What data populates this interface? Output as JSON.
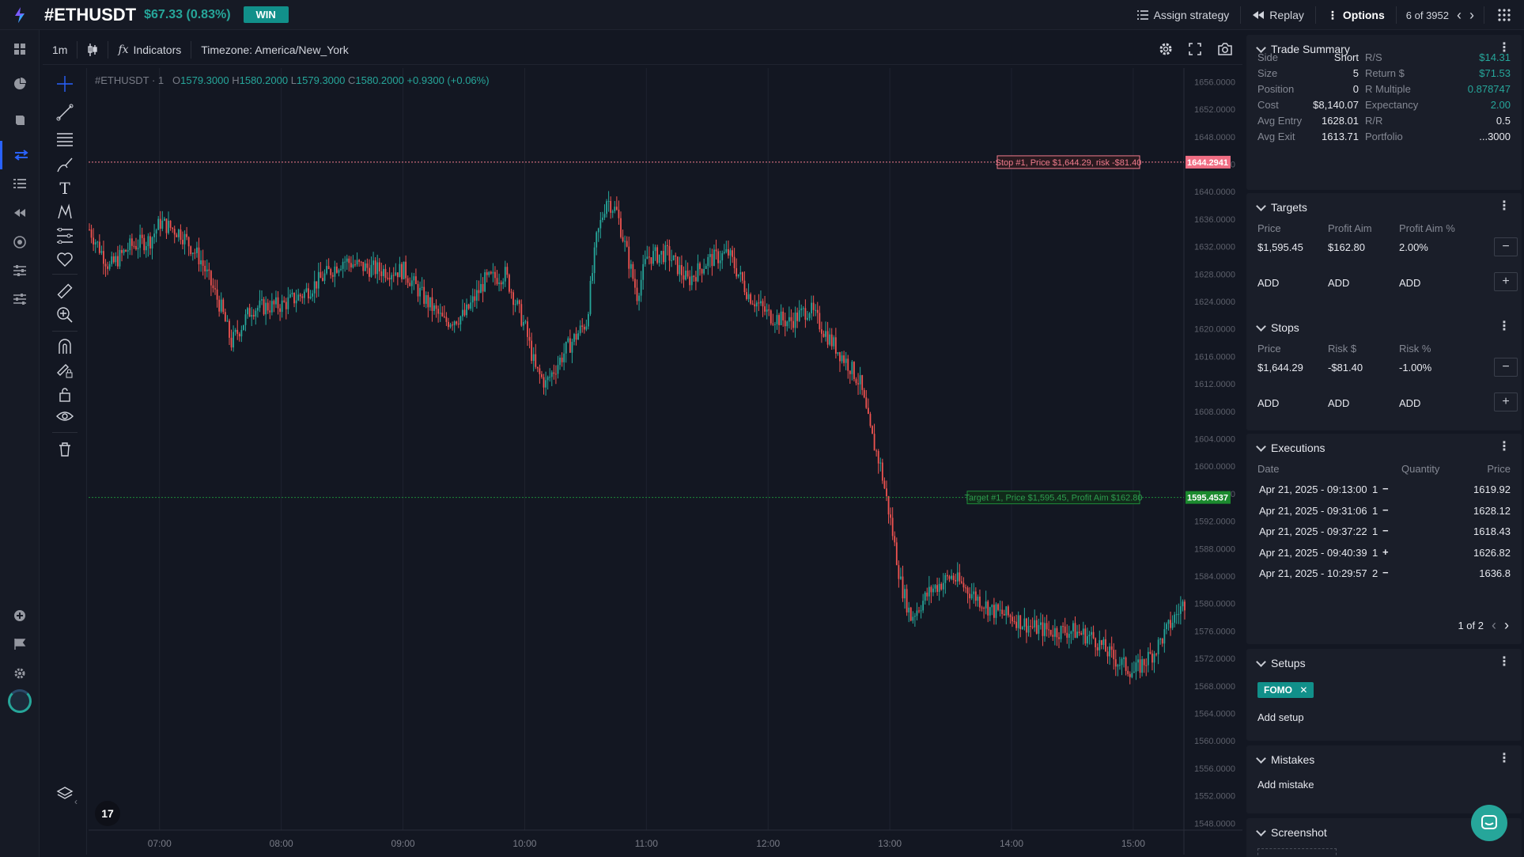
{
  "header": {
    "symbol": "#ETHUSDT",
    "change": "$67.33 (0.83%)",
    "status_badge": "WIN",
    "assign_strategy": "Assign strategy",
    "replay": "Replay",
    "options": "Options",
    "pager": "6 of 3952"
  },
  "chart_toolbar": {
    "interval": "1m",
    "indicators": "Indicators",
    "timezone": "Timezone: America/New_York"
  },
  "legend": {
    "symbol": "#ETHUSDT · 1",
    "o_label": "O",
    "o": "1579.3000",
    "h_label": "H",
    "h": "1580.2000",
    "l_label": "L",
    "l": "1579.3000",
    "c_label": "C",
    "c": "1580.2000",
    "change": "+0.9300 (+0.06%)"
  },
  "chart_data": {
    "type": "candlestick",
    "x_ticks": [
      "07:00",
      "08:00",
      "09:00",
      "10:00",
      "11:00",
      "12:00",
      "13:00",
      "14:00",
      "15:00"
    ],
    "y_ticks": [
      "1656.0000",
      "1652.0000",
      "1648.0000",
      "1644.0000",
      "1640.0000",
      "1636.0000",
      "1632.0000",
      "1628.0000",
      "1624.0000",
      "1620.0000",
      "1616.0000",
      "1612.0000",
      "1608.0000",
      "1604.0000",
      "1600.0000",
      "1596.0000",
      "1592.0000",
      "1588.0000",
      "1584.0000",
      "1580.0000",
      "1576.0000",
      "1572.0000",
      "1568.0000",
      "1564.0000",
      "1560.0000",
      "1556.0000",
      "1552.0000",
      "1548.0000"
    ],
    "y_values": [
      1656,
      1652,
      1648,
      1644,
      1640,
      1636,
      1632,
      1628,
      1624,
      1620,
      1616,
      1612,
      1608,
      1604,
      1600,
      1596,
      1592,
      1588,
      1584,
      1580,
      1576,
      1572,
      1568,
      1564,
      1560,
      1556,
      1552,
      1548
    ],
    "x_range": [
      "06:25",
      "15:25"
    ],
    "ylim": [
      1547,
      1658
    ],
    "price_path": [
      [
        "06:25",
        1634.5
      ],
      [
        "06:35",
        1629
      ],
      [
        "06:45",
        1632
      ],
      [
        "06:55",
        1633
      ],
      [
        "07:00",
        1635.5
      ],
      [
        "07:10",
        1634
      ],
      [
        "07:20",
        1630
      ],
      [
        "07:30",
        1623
      ],
      [
        "07:35",
        1618
      ],
      [
        "07:45",
        1623
      ],
      [
        "08:00",
        1623.5
      ],
      [
        "08:10",
        1625
      ],
      [
        "08:20",
        1627.5
      ],
      [
        "08:30",
        1630
      ],
      [
        "08:40",
        1629
      ],
      [
        "08:50",
        1628.5
      ],
      [
        "09:00",
        1628.5
      ],
      [
        "09:10",
        1624.5
      ],
      [
        "09:20",
        1621
      ],
      [
        "09:30",
        1622
      ],
      [
        "09:40",
        1627
      ],
      [
        "09:50",
        1628
      ],
      [
        "10:00",
        1620
      ],
      [
        "10:05",
        1614
      ],
      [
        "10:10",
        1612
      ],
      [
        "10:20",
        1617
      ],
      [
        "10:30",
        1621
      ],
      [
        "10:35",
        1633
      ],
      [
        "10:40",
        1639
      ],
      [
        "10:45",
        1637
      ],
      [
        "10:50",
        1631
      ],
      [
        "10:55",
        1625
      ],
      [
        "11:00",
        1630.5
      ],
      [
        "11:10",
        1631
      ],
      [
        "11:20",
        1627
      ],
      [
        "11:30",
        1630
      ],
      [
        "11:40",
        1631
      ],
      [
        "11:50",
        1625
      ],
      [
        "12:00",
        1622
      ],
      [
        "12:10",
        1621
      ],
      [
        "12:20",
        1623
      ],
      [
        "12:30",
        1618.5
      ],
      [
        "12:40",
        1614.5
      ],
      [
        "12:45",
        1612
      ],
      [
        "12:50",
        1605
      ],
      [
        "12:55",
        1600
      ],
      [
        "13:00",
        1592
      ],
      [
        "13:05",
        1583
      ],
      [
        "13:10",
        1578
      ],
      [
        "13:20",
        1582
      ],
      [
        "13:30",
        1584
      ],
      [
        "13:40",
        1581.5
      ],
      [
        "13:50",
        1579
      ],
      [
        "14:00",
        1578
      ],
      [
        "14:10",
        1576.5
      ],
      [
        "14:20",
        1576
      ],
      [
        "14:30",
        1576
      ],
      [
        "14:40",
        1575
      ],
      [
        "14:50",
        1572
      ],
      [
        "15:00",
        1570
      ],
      [
        "15:10",
        1573
      ],
      [
        "15:20",
        1578
      ],
      [
        "15:25",
        1580.2
      ]
    ],
    "series": [
      {
        "name": "Stop #1",
        "price": 1644.2941,
        "axis_label": "1644.2941",
        "label": "Stop #1, Price $1,644.29, risk -$81.40",
        "color": "#f07b8c"
      },
      {
        "name": "Target #1",
        "price": 1595.4537,
        "axis_label": "1595.4537",
        "label": "Target #1, Price $1,595.45, Profit Aim $162.80",
        "color": "#1e8a3a"
      }
    ],
    "colors": {
      "up": "#26a69a",
      "down": "#ef5350"
    }
  },
  "trade_summary": {
    "title": "Trade Summary",
    "left": [
      {
        "label": "Side",
        "value": "Short"
      },
      {
        "label": "Size",
        "value": "5"
      },
      {
        "label": "Position",
        "value": "0"
      },
      {
        "label": "Cost",
        "value": "$8,140.07"
      },
      {
        "label": "Avg Entry",
        "value": "1628.01"
      },
      {
        "label": "Avg Exit",
        "value": "1613.71"
      }
    ],
    "right": [
      {
        "label": "R/S",
        "value": "$14.31"
      },
      {
        "label": "Return $",
        "value": "$71.53"
      },
      {
        "label": "R Multiple",
        "value": "0.878747"
      },
      {
        "label": "Expectancy",
        "value": "2.00"
      },
      {
        "label": "R/R",
        "value": "0.5"
      },
      {
        "label": "Portfolio",
        "value": "...3000"
      }
    ]
  },
  "targets": {
    "title": "Targets",
    "headers": [
      "Price",
      "Profit Aim",
      "Profit Aim %"
    ],
    "row": [
      "$1,595.45",
      "$162.80",
      "2.00%"
    ],
    "add_labels": [
      "ADD",
      "ADD",
      "ADD"
    ]
  },
  "stops": {
    "title": "Stops",
    "headers": [
      "Price",
      "Risk $",
      "Risk %"
    ],
    "row": [
      "$1,644.29",
      "-$81.40",
      "-1.00%"
    ],
    "add_labels": [
      "ADD",
      "ADD",
      "ADD"
    ]
  },
  "executions": {
    "title": "Executions",
    "headers": [
      "Date",
      "Quantity",
      "Price"
    ],
    "rows": [
      {
        "date": "Apr 21, 2025 - 09:13:00",
        "qty": "1",
        "sign": "−",
        "price": "1619.92"
      },
      {
        "date": "Apr 21, 2025 - 09:31:06",
        "qty": "1",
        "sign": "−",
        "price": "1628.12"
      },
      {
        "date": "Apr 21, 2025 - 09:37:22",
        "qty": "1",
        "sign": "−",
        "price": "1618.43"
      },
      {
        "date": "Apr 21, 2025 - 09:40:39",
        "qty": "1",
        "sign": "+",
        "price": "1626.82"
      },
      {
        "date": "Apr 21, 2025 - 10:29:57",
        "qty": "2",
        "sign": "−",
        "price": "1636.8"
      }
    ],
    "pager": "1 of 2"
  },
  "setups": {
    "title": "Setups",
    "tag": "FOMO",
    "add": "Add setup"
  },
  "mistakes": {
    "title": "Mistakes",
    "add": "Add mistake"
  },
  "screenshot": {
    "title": "Screenshot"
  }
}
